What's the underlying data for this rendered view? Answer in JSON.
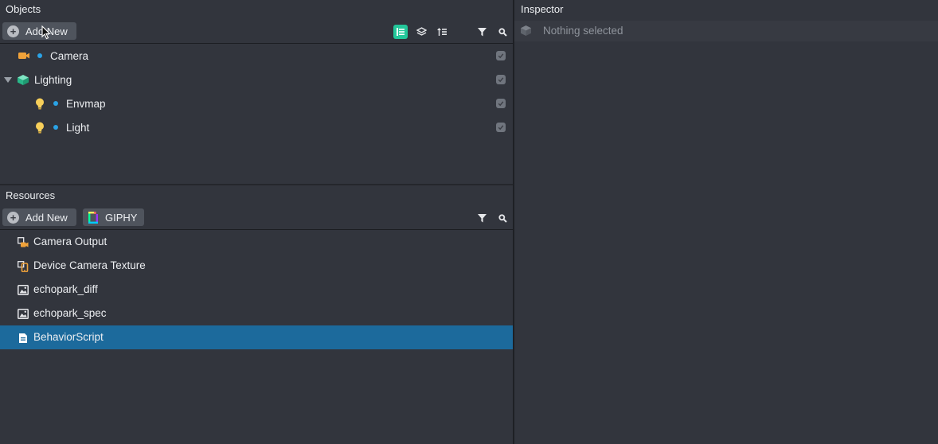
{
  "objects_panel": {
    "title": "Objects",
    "add_new_label": "Add New",
    "items": [
      {
        "label": "Camera",
        "icon": "camera-icon",
        "has_dot": true,
        "expandable": false
      },
      {
        "label": "Lighting",
        "icon": "light-rig-icon",
        "has_dot": false,
        "expandable": true
      },
      {
        "label": "Envmap",
        "icon": "bulb-icon",
        "has_dot": true,
        "expandable": false
      },
      {
        "label": "Light",
        "icon": "bulb-icon",
        "has_dot": true,
        "expandable": false
      }
    ]
  },
  "resources_panel": {
    "title": "Resources",
    "add_new_label": "Add New",
    "giphy_label": "GIPHY",
    "items": [
      {
        "label": "Camera Output",
        "icon": "camera-output-icon",
        "selected": false
      },
      {
        "label": "Device Camera Texture",
        "icon": "device-camera-texture-icon",
        "selected": false
      },
      {
        "label": "echopark_diff",
        "icon": "image-icon",
        "selected": false
      },
      {
        "label": "echopark_spec",
        "icon": "image-icon",
        "selected": false
      },
      {
        "label": "BehaviorScript",
        "icon": "script-icon",
        "selected": true
      }
    ]
  },
  "inspector_panel": {
    "title": "Inspector",
    "empty_text": "Nothing selected"
  },
  "colors": {
    "background": "#32353d",
    "accent_green": "#23c79a",
    "selection_blue": "#1c6a9c",
    "dot_blue": "#2aa3e6",
    "camera_orange": "#f0a23a",
    "bulb_yellow": "#f7cf5a"
  }
}
